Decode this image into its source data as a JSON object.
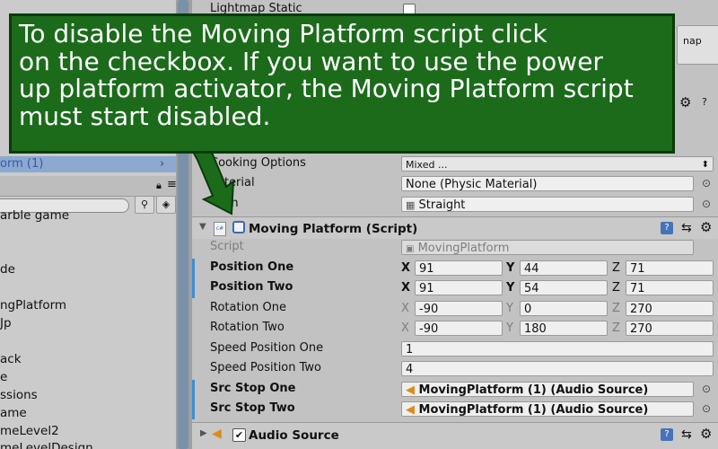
{
  "hierarchy": {
    "selected_item": "orm (1)",
    "items": [
      "arble game",
      "de",
      "ngPlatform",
      "Jp",
      "ack",
      "e",
      "ssions",
      "ame",
      "meLevel2",
      "meLevelDesign"
    ]
  },
  "inspector": {
    "lightmap_static_label": "Lightmap Static",
    "map_button": "nap",
    "cooking_options_label": "Cooking Options",
    "cooking_options_value": "Mixed ...",
    "material_label": "aterial",
    "material_value": "None (Physic Material)",
    "mesh_label": "M   h",
    "mesh_value": "Straight",
    "moving_platform": {
      "title": "Moving Platform (Script)",
      "script_label": "Script",
      "script_value": "MovingPlatform",
      "rows": [
        {
          "label": "Position One",
          "bold": true,
          "x": "91",
          "y": "44",
          "z": "71"
        },
        {
          "label": "Position Two",
          "bold": true,
          "x": "91",
          "y": "54",
          "z": "71"
        },
        {
          "label": "Rotation One",
          "bold": false,
          "x": "-90",
          "y": "0",
          "z": "270"
        },
        {
          "label": "Rotation Two",
          "bold": false,
          "x": "-90",
          "y": "180",
          "z": "270"
        }
      ],
      "axis_labels": {
        "x": "X",
        "y": "Y",
        "z": "Z"
      },
      "speed_one_label": "Speed Position One",
      "speed_one_value": "1",
      "speed_two_label": "Speed Position Two",
      "speed_two_value": "4",
      "src_stop_one_label": "Src Stop One",
      "src_stop_one_value": "MovingPlatform (1) (Audio Source)",
      "src_stop_two_label": "Src Stop Two",
      "src_stop_two_value": "MovingPlatform (1) (Audio Source)"
    },
    "audio_source_title": "Audio Source"
  },
  "callout": {
    "text": "To disable the Moving Platform script click\non the checkbox.  If you want to use the power\nup platform activator, the Moving Platform script\nmust start disabled."
  },
  "colors": {
    "callout_bg": "#1b6b1b",
    "selection": "#8ea9cf",
    "accent_blue": "#3b8fd6"
  }
}
